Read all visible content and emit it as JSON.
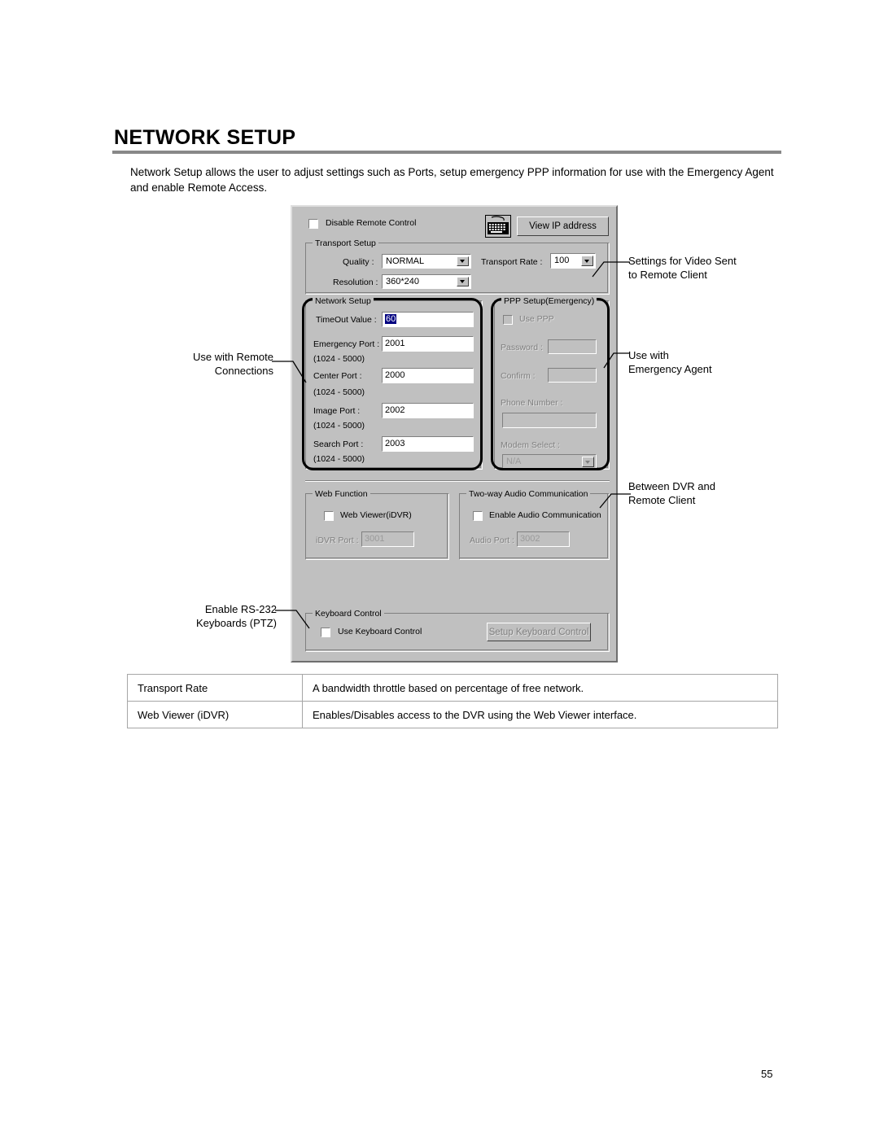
{
  "page": {
    "title": "NETWORK SETUP",
    "intro": "Network Setup allows the user to adjust settings such as Ports, setup emergency PPP information for use with the Emergency Agent and enable Remote Access.",
    "page_number": "55"
  },
  "dialog": {
    "disable_remote_control": {
      "label": "Disable Remote Control",
      "checked": false
    },
    "keyboard_icon": "keyboard-icon",
    "view_ip_button": "View  IP address",
    "transport_setup": {
      "title": "Transport Setup",
      "quality_label": "Quality :",
      "quality_value": "NORMAL",
      "resolution_label": "Resolution :",
      "resolution_value": "360*240",
      "transport_rate_label": "Transport Rate :",
      "transport_rate_value": "100"
    },
    "network_setup": {
      "title": "Network Setup",
      "timeout_label": "TimeOut Value :",
      "timeout_value": "60",
      "emergency_port_label": "Emergency Port :",
      "emergency_port_value": "2001",
      "emergency_port_range": "(1024 - 5000)",
      "center_port_label": "Center Port :",
      "center_port_value": "2000",
      "center_port_range": "(1024 - 5000)",
      "image_port_label": "Image Port :",
      "image_port_value": "2002",
      "image_port_range": "(1024 - 5000)",
      "search_port_label": "Search Port :",
      "search_port_value": "2003",
      "search_port_range": "(1024 - 5000)"
    },
    "ppp_setup": {
      "title": "PPP Setup(Emergency)",
      "use_ppp_label": "Use PPP",
      "password_label": "Password :",
      "password_value": "",
      "confirm_label": "Confirm :",
      "confirm_value": "",
      "phone_number_label": "Phone Number :",
      "phone_number_value": "",
      "modem_select_label": "Modem Select :",
      "modem_select_value": "N/A"
    },
    "web_function": {
      "title": "Web Function",
      "web_viewer_label": "Web Viewer(iDVR)",
      "idvr_port_label": "iDVR Port :",
      "idvr_port_value": "3001"
    },
    "audio": {
      "title": "Two-way Audio Communication",
      "enable_label": "Enable Audio Communication",
      "audio_port_label": "Audio Port :",
      "audio_port_value": "3002"
    },
    "keyboard_control": {
      "title": "Keyboard Control",
      "use_label": "Use Keyboard Control",
      "setup_button": "Setup Keyboard Control"
    }
  },
  "annotations": {
    "video_settings": "Settings for Video Sent\nto Remote Client",
    "video_settings_l1": "Settings for Video Sent",
    "video_settings_l2": "to Remote Client",
    "remote_connections_l1": "Use with Remote",
    "remote_connections_l2": "Connections",
    "emergency_agent_l1": "Use with",
    "emergency_agent_l2": "Emergency Agent",
    "between_dvr_l1": "Between DVR and",
    "between_dvr_l2": "Remote Client",
    "rs232_l1": "Enable RS-232",
    "rs232_l2": "Keyboards (PTZ)"
  },
  "table": {
    "rows": [
      {
        "term": "Transport Rate",
        "description": "A bandwidth throttle based on percentage of free network."
      },
      {
        "term": "Web Viewer (iDVR)",
        "description": "Enables/Disables access to the DVR using the Web Viewer interface."
      }
    ]
  },
  "colors": {
    "dialog_face": "#c0c0c0",
    "selection": "#000080",
    "rule": "#888888"
  }
}
